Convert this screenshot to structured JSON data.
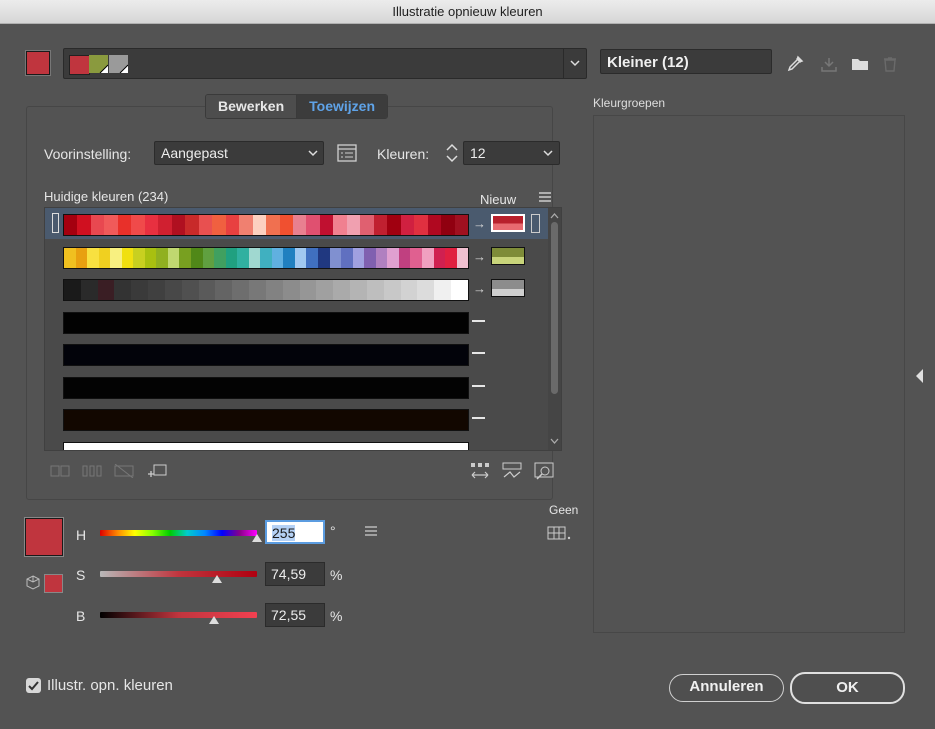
{
  "window": {
    "title": "Illustratie opnieuw kleuren"
  },
  "colors": {
    "current": "#c0353e",
    "accent": "#5fa3e8",
    "group_swatches": [
      "#c0353e",
      "#8a9a3e",
      "#9a9a9a"
    ]
  },
  "toolbar": {
    "group_name": "Kleiner (12)",
    "icons": [
      "eyedropper-icon",
      "save-group-icon",
      "folder-icon",
      "trash-icon"
    ]
  },
  "tabs": [
    {
      "label": "Bewerken",
      "active": false
    },
    {
      "label": "Toewijzen",
      "active": true
    }
  ],
  "preset": {
    "label": "Voorinstelling:",
    "value": "Aangepast"
  },
  "colors_count": {
    "label": "Kleuren:",
    "value": "12"
  },
  "table": {
    "current_header": "Huidige kleuren (234)",
    "new_header": "Nieuw",
    "rows": [
      {
        "selected": true,
        "mapped": true,
        "new": [
          "#b8202c",
          "#e86a70"
        ],
        "strip": [
          "#a4000f",
          "#d01020",
          "#e84850",
          "#f05a5a",
          "#e8302a",
          "#f04a4a",
          "#e83040",
          "#d02030",
          "#b01020",
          "#c82a2a",
          "#e85050",
          "#f06040",
          "#e84040",
          "#f08070",
          "#fcd0c0",
          "#f07050",
          "#f05030",
          "#e88090",
          "#e05070",
          "#c01030",
          "#f08090",
          "#f0a0b0",
          "#e06070",
          "#c02030",
          "#a00010",
          "#d02040",
          "#e03040",
          "#b00820",
          "#900010",
          "#a01020"
        ]
      },
      {
        "selected": false,
        "mapped": true,
        "new": [
          "#7e8c38",
          "#c8d47a"
        ],
        "strip": [
          "#f0c020",
          "#e8a010",
          "#f8e040",
          "#f0d020",
          "#f8f080",
          "#f0e010",
          "#c8d020",
          "#a8c010",
          "#90b020",
          "#c0d870",
          "#78a020",
          "#508818",
          "#60a040",
          "#40a060",
          "#20a080",
          "#30b0a0",
          "#a0d8d0",
          "#40b0c0",
          "#60b0e0",
          "#2080c0",
          "#a0c8f0",
          "#4070c0",
          "#203880",
          "#8090d0",
          "#6070c0",
          "#a0a0e0",
          "#8060b0",
          "#b080c0",
          "#e0a0d0",
          "#c04080",
          "#e06090",
          "#f0a0c0",
          "#d02050",
          "#e02040",
          "#f0c0d0"
        ]
      },
      {
        "selected": false,
        "mapped": true,
        "new": [
          "#8c8c8c",
          "#cfcfcf"
        ],
        "strip": [
          "#1a1a1a",
          "#2a2a2a",
          "#3a1e24",
          "#333",
          "#3a3a3a",
          "#404040",
          "#484848",
          "#505050",
          "#5a5a5a",
          "#646464",
          "#6e6e6e",
          "#787878",
          "#828282",
          "#8c8c8c",
          "#969696",
          "#a0a0a0",
          "#aaaaaa",
          "#b4b4b4",
          "#bebebe",
          "#c8c8c8",
          "#d2d2d2",
          "#dcdcdc",
          "#f0f0f0",
          "#ffffff"
        ]
      },
      {
        "selected": false,
        "mapped": false,
        "solid": "#020202"
      },
      {
        "selected": false,
        "mapped": false,
        "solid": "#02030a"
      },
      {
        "selected": false,
        "mapped": false,
        "solid": "#030303"
      },
      {
        "selected": false,
        "mapped": false,
        "solid": "#120700"
      },
      {
        "selected": false,
        "mapped": false,
        "solid": "#ffffff"
      }
    ]
  },
  "groups_panel": {
    "label": "Kleurgroepen"
  },
  "hsb": {
    "h_label": "H",
    "h_value": "255",
    "h_unit": "°",
    "s_label": "S",
    "s_value": "74,59",
    "s_unit": "%",
    "b_label": "B",
    "b_value": "72,55",
    "b_unit": "%",
    "h_position": 1.0,
    "s_position": 0.746,
    "b_position": 0.726
  },
  "none_label": "Geen",
  "recolor_checkbox": {
    "label": "Illustr. opn. kleuren",
    "checked": true
  },
  "buttons": {
    "cancel": "Annuleren",
    "ok": "OK"
  }
}
